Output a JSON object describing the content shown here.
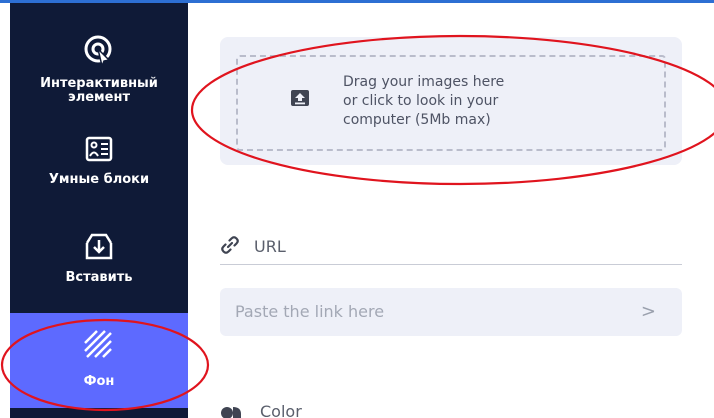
{
  "sidebar": {
    "items": [
      {
        "label_line1": "Интерактивный",
        "label_line2": "элемент",
        "icon": "interactive-element-icon"
      },
      {
        "label": "Умные блоки",
        "icon": "smart-blocks-icon"
      },
      {
        "label": "Вставить",
        "icon": "insert-icon"
      },
      {
        "label": "Фон",
        "icon": "background-icon",
        "active": true
      }
    ]
  },
  "upload": {
    "line1": "Drag your images here",
    "line2": "or click to look in your",
    "line3": "computer (5Mb max)",
    "icon": "upload-icon"
  },
  "url": {
    "label": "URL",
    "icon": "link-icon",
    "placeholder": "Paste the link here",
    "submit_glyph": ">"
  },
  "color": {
    "label": "Color",
    "icon": "color-icon"
  },
  "colors": {
    "sidebar_bg": "#0f1a37",
    "active_bg": "#5d6aff",
    "panel_bg": "#eef0f8",
    "annotation": "#e0141e",
    "top_border": "#2d6fd3"
  }
}
